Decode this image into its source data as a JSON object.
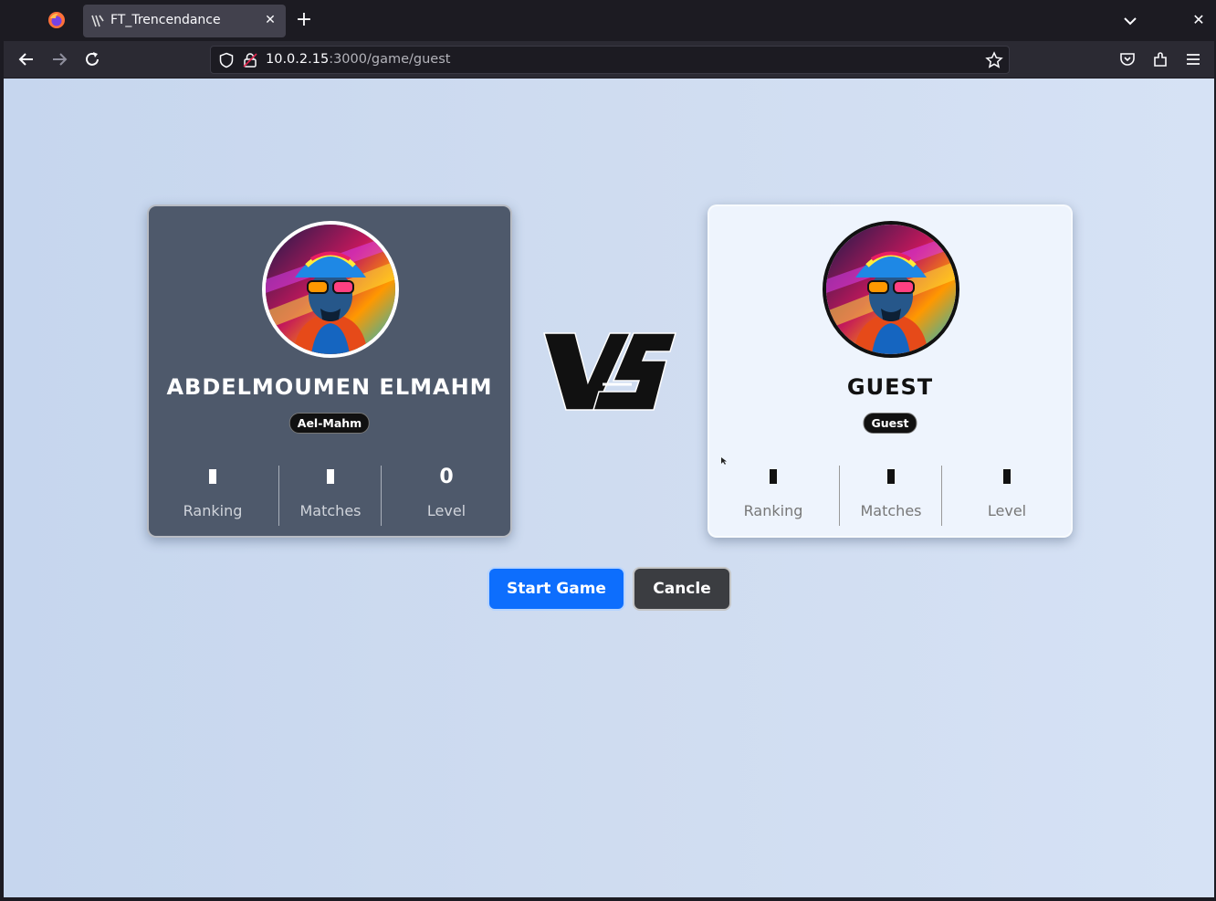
{
  "browser": {
    "tab_title": "FT_Trencendance",
    "url_host": "10.0.2.15",
    "url_path": ":3000/game/guest"
  },
  "player1": {
    "name": "ABDELMOUMEN ELMAHM",
    "username": "Ael-Mahm",
    "stats": [
      {
        "label": "Ranking",
        "value": ""
      },
      {
        "label": "Matches",
        "value": ""
      },
      {
        "label": "Level",
        "value": "0"
      }
    ]
  },
  "player2": {
    "name": "GUEST",
    "username": "Guest",
    "stats": [
      {
        "label": "Ranking",
        "value": ""
      },
      {
        "label": "Matches",
        "value": ""
      },
      {
        "label": "Level",
        "value": ""
      }
    ]
  },
  "actions": {
    "start_label": "Start Game",
    "cancel_label": "Cancle"
  },
  "colors": {
    "accent": "#0d6efd",
    "dark_card": "#4e596b",
    "light_card": "#eef4fd"
  }
}
